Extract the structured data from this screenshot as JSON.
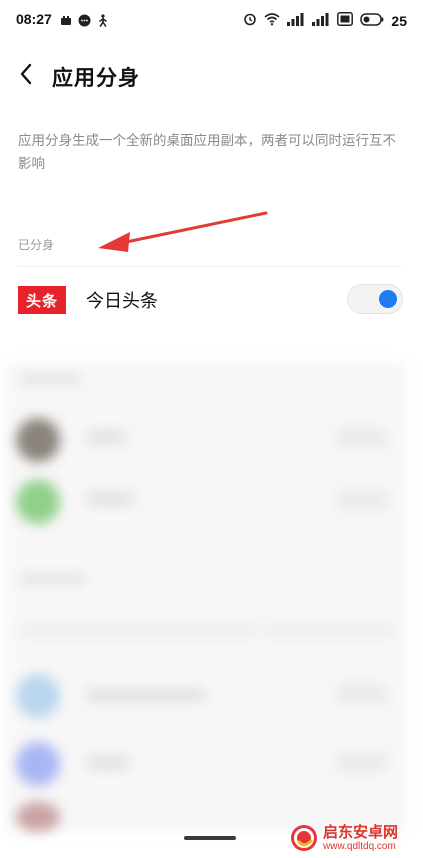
{
  "status_bar": {
    "time": "08:27",
    "battery_level": "25",
    "left_icons": [
      "notification-icon",
      "message-icon",
      "walk-icon"
    ],
    "right_icons": [
      "alarm-icon",
      "wifi-icon",
      "signal-icon",
      "signal-icon",
      "hd-icon",
      "battery-icon"
    ]
  },
  "header": {
    "back_icon": "chevron-left-icon",
    "title": "应用分身"
  },
  "description": "应用分身生成一个全新的桌面应用副本，两者可以同时运行互不影响",
  "cloned_section": {
    "label": "已分身",
    "apps": [
      {
        "icon_text": "头条",
        "name": "今日头条",
        "enabled": true
      }
    ]
  },
  "colors": {
    "toggle_on": "#1e7cf2",
    "toutiao_red": "#e8222a",
    "annotation_arrow": "#e53935"
  },
  "watermark": {
    "name": "启东安卓网",
    "url": "www.qdltdq.com"
  }
}
